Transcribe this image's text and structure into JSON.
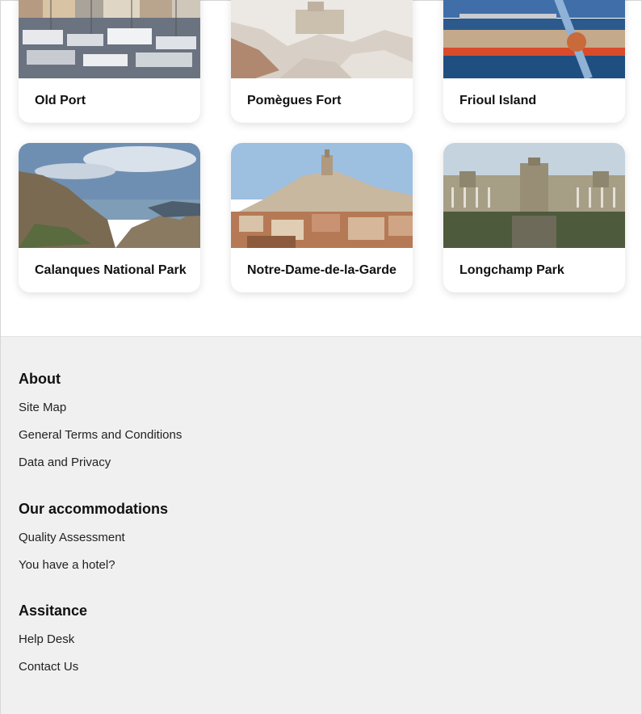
{
  "cards": [
    {
      "title": "Old Port",
      "image": "harbor-boats-photo"
    },
    {
      "title": "Pomègues Fort",
      "image": "fort-rocks-photo"
    },
    {
      "title": "Frioul Island",
      "image": "island-ferry-photo"
    },
    {
      "title": "Calanques National Park",
      "image": "cliffs-sea-photo"
    },
    {
      "title": "Notre-Dame-de-la-Garde",
      "image": "basilica-hill-photo"
    },
    {
      "title": "Longchamp Park",
      "image": "palace-colonnade-photo"
    }
  ],
  "footer": {
    "about": {
      "heading": "About",
      "links": [
        "Site Map",
        "General Terms and Conditions",
        "Data and Privacy"
      ]
    },
    "accommodations": {
      "heading": "Our accommodations",
      "links": [
        "Quality Assessment",
        "You have a hotel?"
      ]
    },
    "assistance": {
      "heading": "Assitance",
      "links": [
        "Help Desk",
        "Contact Us"
      ]
    }
  }
}
